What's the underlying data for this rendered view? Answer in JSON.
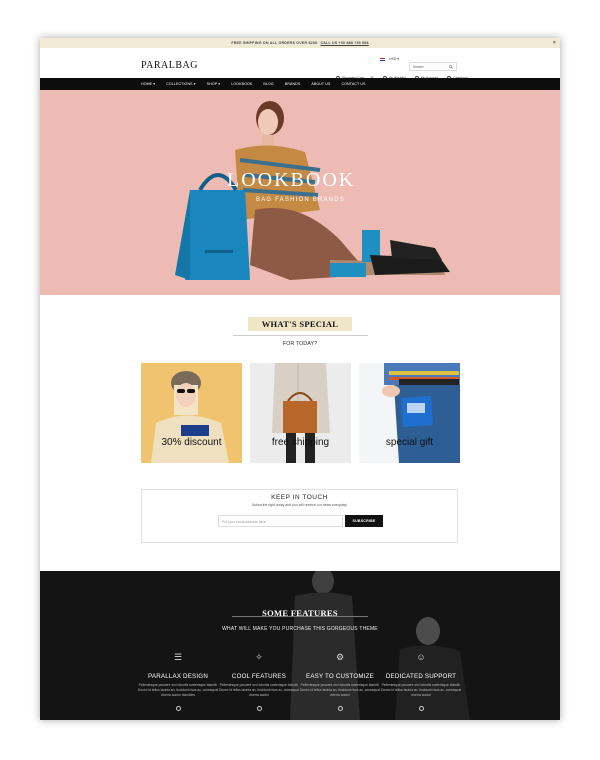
{
  "topbar": {
    "text": "FREE SHIPPING ON ALL ORDERS OVER $200.",
    "phone": "CALL US +00 888 735 588",
    "close": "×"
  },
  "header": {
    "logo": "PARALBAG",
    "currency": "USD ▾",
    "search_placeholder": "Search",
    "shopping_cart": "Shopping Cart",
    "cart_count": "0",
    "wishlist": "My Wishlist",
    "account": "My Account",
    "checkout": "Checkout"
  },
  "nav": {
    "items": [
      "HOME ▾",
      "COLLECTIONS ▾",
      "SHOP ▾",
      "LOOKBOOK",
      "BLOG",
      "BRANDS",
      "ABOUT US",
      "CONTACT US"
    ]
  },
  "hero": {
    "title": "LOOKBOOK",
    "subtitle": "BAG FASHION BRANDS"
  },
  "special": {
    "title": "WHAT'S SPECIAL",
    "subtitle": "FOR TODAY?"
  },
  "cards": [
    {
      "label": "30% discount"
    },
    {
      "label": "free shipping"
    },
    {
      "label": "special gift"
    }
  ],
  "newsletter": {
    "title": "KEEP IN TOUCH",
    "message": "Subscribe right away and you will receive our news everyday!",
    "placeholder": "Put your email address here",
    "button": "SUBSCRIBE"
  },
  "features": {
    "title": "SOME FEATURES",
    "tagline": "WHAT WILL MAKE YOU PURCHASE THIS GORGEOUS THEME",
    "items": [
      {
        "name": "PARALLAX DESIGN",
        "icon": "layers-icon",
        "desc": "Pellentesque posuere orci lobortis scelerisque blandit. Donec id tellus lacinia an, tincidunt risus ac, consequat viverra auctor blandites"
      },
      {
        "name": "COOL FEATURES",
        "icon": "magic-wand-icon",
        "desc": "Pellentesque posuere orci lobortis scelerisque blandit. Donec id tellus lacinia an, tincidunt risus ac, consequat viverra auctor"
      },
      {
        "name": "EASY TO CUSTOMIZE",
        "icon": "gear-icon",
        "desc": "Pellentesque posuere orci lobortis scelerisque blandit. Donec id tellus lacinia an, tincidunt risus ac, consequat viverra auctor"
      },
      {
        "name": "DEDICATED SUPPORT",
        "icon": "users-icon",
        "desc": "Pellentesque posuere orci lobortis scelerisque blandit. Donec id tellus lacinia an, tincidunt risus ac, consequat viverra auctor"
      }
    ]
  },
  "colors": {
    "topbar": "#f1ead7",
    "nav": "#0d0d0d",
    "hero_bg": "#edbbb3",
    "accent": "#efe5c7",
    "dark_section": "#1b1b1b"
  }
}
